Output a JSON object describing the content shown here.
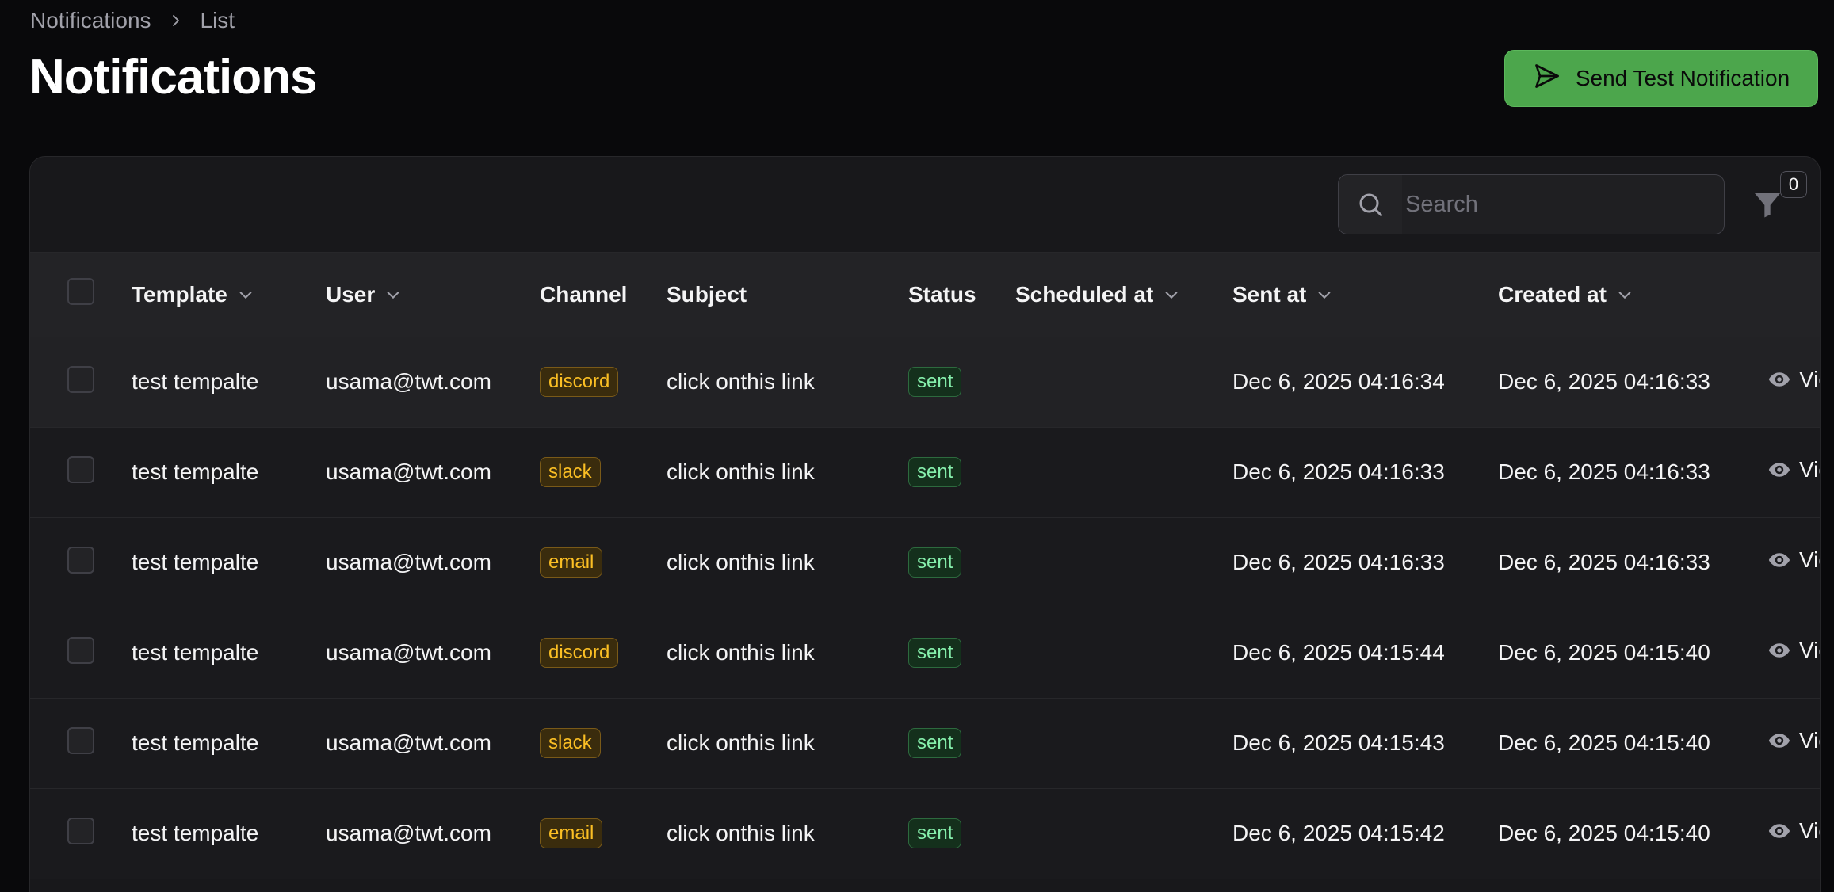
{
  "breadcrumb": {
    "items": [
      "Notifications",
      "List"
    ]
  },
  "page": {
    "title": "Notifications"
  },
  "actions": {
    "send_test_label": "Send Test Notification"
  },
  "search": {
    "placeholder": "Search"
  },
  "filter": {
    "count": "0"
  },
  "table": {
    "columns": [
      "Template",
      "User",
      "Channel",
      "Subject",
      "Status",
      "Scheduled at",
      "Sent at",
      "Created at"
    ],
    "view_label": "View",
    "rows": [
      {
        "template": "test tempalte",
        "user": "usama@twt.com",
        "channel": "discord",
        "subject": "click onthis link",
        "status": "sent",
        "scheduled_at": "",
        "sent_at": "Dec 6, 2025 04:16:34",
        "created_at": "Dec 6, 2025 04:16:33"
      },
      {
        "template": "test tempalte",
        "user": "usama@twt.com",
        "channel": "slack",
        "subject": "click onthis link",
        "status": "sent",
        "scheduled_at": "",
        "sent_at": "Dec 6, 2025 04:16:33",
        "created_at": "Dec 6, 2025 04:16:33"
      },
      {
        "template": "test tempalte",
        "user": "usama@twt.com",
        "channel": "email",
        "subject": "click onthis link",
        "status": "sent",
        "scheduled_at": "",
        "sent_at": "Dec 6, 2025 04:16:33",
        "created_at": "Dec 6, 2025 04:16:33"
      },
      {
        "template": "test tempalte",
        "user": "usama@twt.com",
        "channel": "discord",
        "subject": "click onthis link",
        "status": "sent",
        "scheduled_at": "",
        "sent_at": "Dec 6, 2025 04:15:44",
        "created_at": "Dec 6, 2025 04:15:40"
      },
      {
        "template": "test tempalte",
        "user": "usama@twt.com",
        "channel": "slack",
        "subject": "click onthis link",
        "status": "sent",
        "scheduled_at": "",
        "sent_at": "Dec 6, 2025 04:15:43",
        "created_at": "Dec 6, 2025 04:15:40"
      },
      {
        "template": "test tempalte",
        "user": "usama@twt.com",
        "channel": "email",
        "subject": "click onthis link",
        "status": "sent",
        "scheduled_at": "",
        "sent_at": "Dec 6, 2025 04:15:42",
        "created_at": "Dec 6, 2025 04:15:40"
      }
    ]
  },
  "colors": {
    "accent": "#4ca64c",
    "channel_badge": "#fbbf24",
    "status_badge": "#86efac",
    "background": "#09090b"
  }
}
